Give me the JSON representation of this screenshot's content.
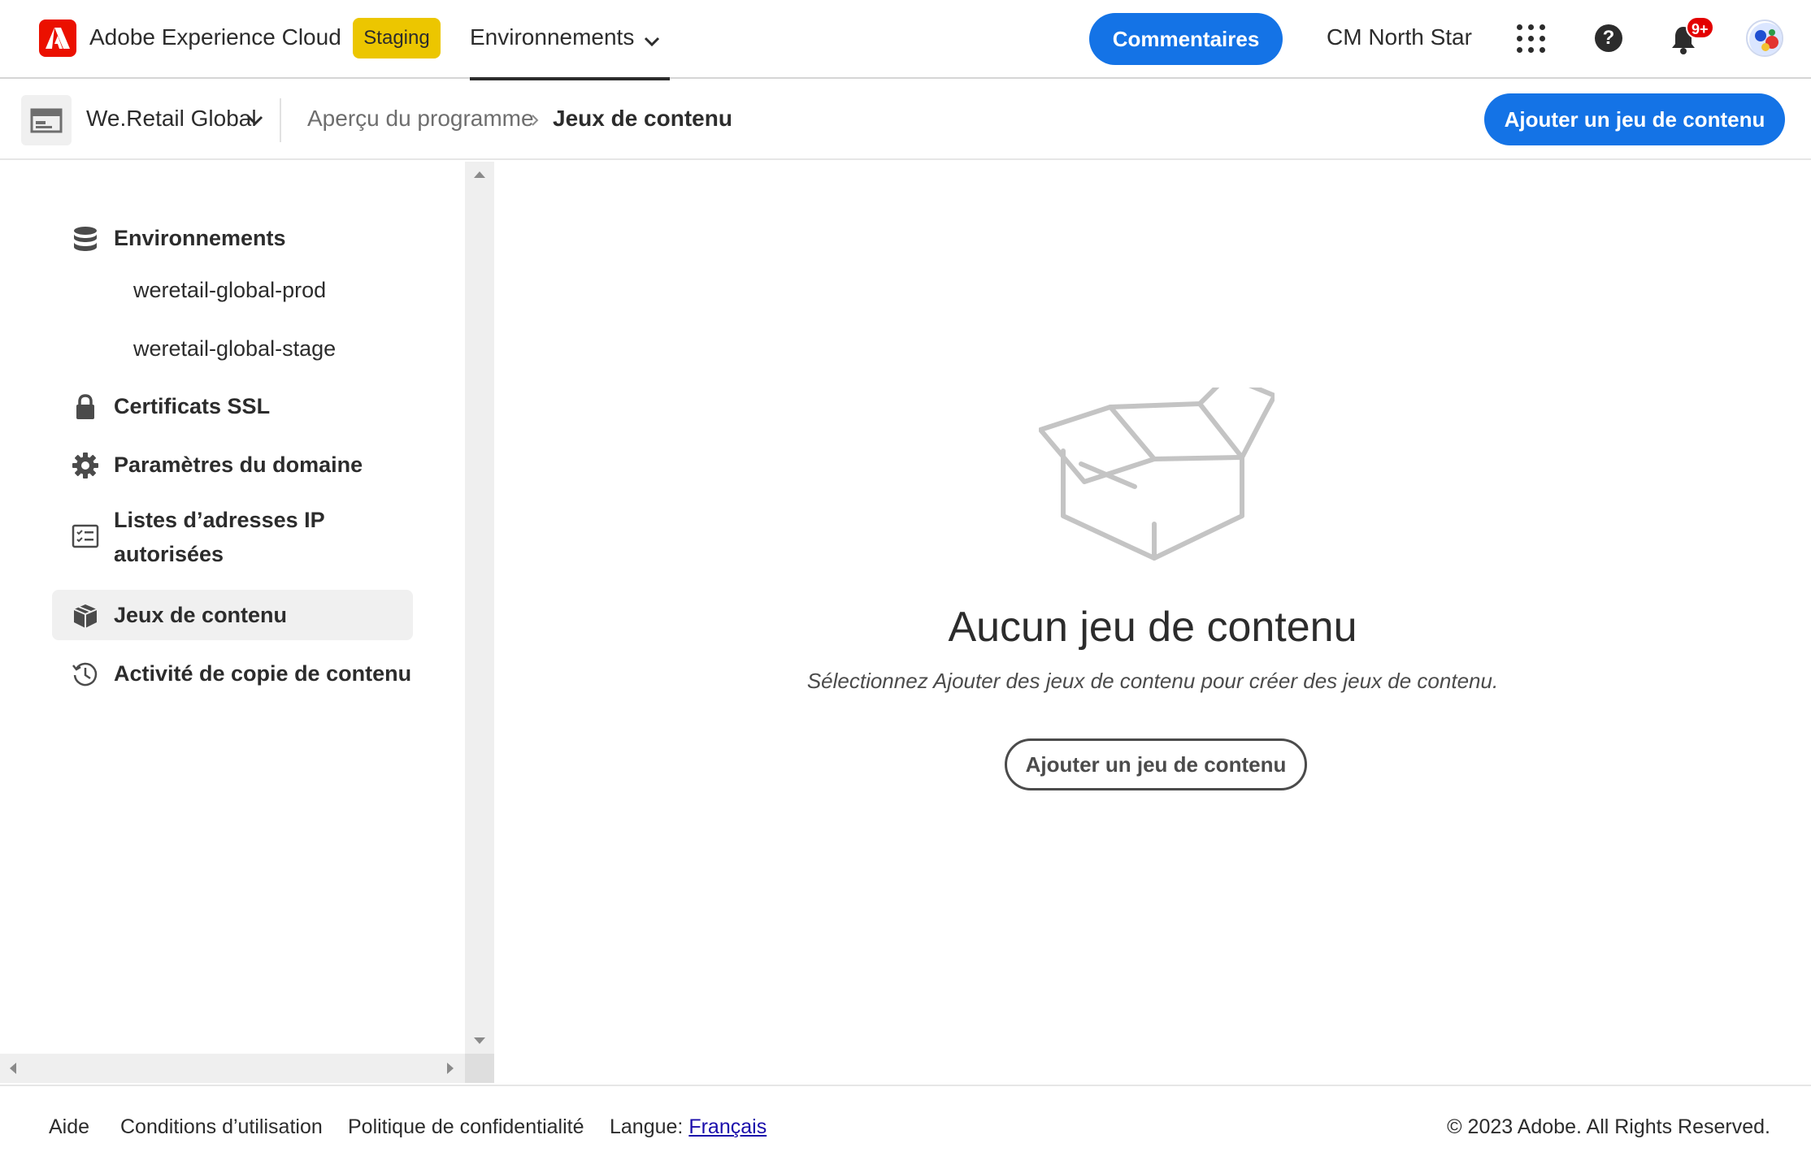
{
  "shell": {
    "title": "Adobe Experience Cloud",
    "env_badge": "Staging",
    "env_tab": "Environnements",
    "feedback_label": "Commentaires",
    "org_name": "CM North Star",
    "notification_count": "9+",
    "brand_color": "#eb1000",
    "accent_color": "#1473e6"
  },
  "subheader": {
    "program_name": "We.Retail Global",
    "breadcrumb": [
      "Aperçu du programme",
      "Jeux de contenu"
    ],
    "add_button": "Ajouter un jeu de contenu"
  },
  "sidebar": {
    "items": [
      {
        "label": "Environnements",
        "icon": "database-icon"
      },
      {
        "label": "weretail-global-prod"
      },
      {
        "label": "weretail-global-stage"
      },
      {
        "label": "Certificats SSL",
        "icon": "lock-icon"
      },
      {
        "label": "Paramètres du domaine",
        "icon": "gear-icon"
      },
      {
        "label": "Listes d’adresses IP",
        "label2": "autorisées",
        "icon": "checklist-icon"
      },
      {
        "label": "Jeux de contenu",
        "icon": "box-icon",
        "active": true
      },
      {
        "label": "Activité de copie de contenu",
        "icon": "history-icon"
      }
    ]
  },
  "main": {
    "empty_title": "Aucun jeu de contenu",
    "empty_description": "Sélectionnez Ajouter des jeux de contenu pour créer des jeux de contenu.",
    "add_button": "Ajouter un jeu de contenu",
    "illustration_icon": "open-box-icon"
  },
  "footer": {
    "help": "Aide",
    "terms": "Conditions d’utilisation",
    "privacy": "Politique de confidentialité",
    "language_label": "Langue:",
    "language_value": "Français",
    "copyright": "© 2023 Adobe. All Rights Reserved."
  }
}
